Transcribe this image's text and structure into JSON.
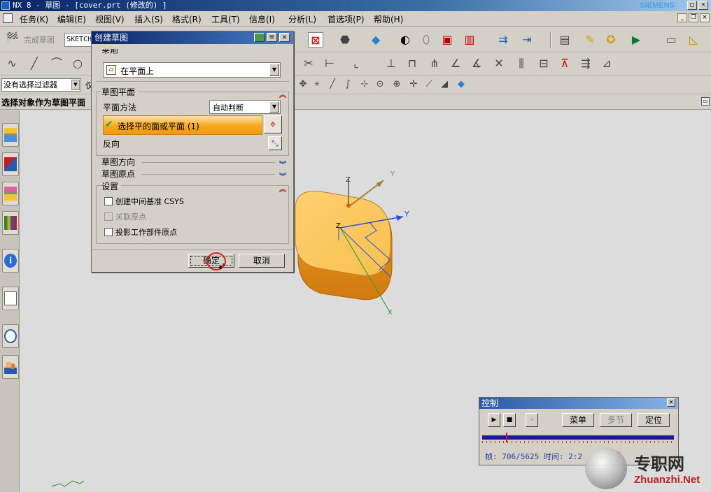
{
  "window": {
    "title": "NX 8 - 草图 - [cover.prt (修改的) ]",
    "brand": "SIEMENS"
  },
  "menu": [
    "任务(K)",
    "编辑(E)",
    "视图(V)",
    "插入(S)",
    "格式(R)",
    "工具(T)",
    "信息(I)",
    "分析(L)",
    "首选项(P)",
    "帮助(H)"
  ],
  "sketch_toolbar": {
    "finish_label": "完成草图",
    "sketch_name": "SKETCH_"
  },
  "filter": {
    "value": "没有选择过滤器",
    "partial": "仅"
  },
  "prompt": "选择对象作为草图平面",
  "dialog": {
    "title": "创建草图",
    "type_group": "类型",
    "type_value": "在平面上",
    "plane_group": "草图平面",
    "plane_method_label": "平面方法",
    "plane_method_value": "自动判断",
    "select_face_label": "选择平的面或平面 (1)",
    "reverse_label": "反向",
    "orientation_group": "草图方向",
    "origin_group": "草图原点",
    "settings_group": "设置",
    "opt1": "创建中间基准 CSYS",
    "opt2": "关联原点",
    "opt3": "投影工作部件原点",
    "ok": "确定",
    "cancel": "取消"
  },
  "axes": {
    "x": "X",
    "y": "Y",
    "z": "Z"
  },
  "control": {
    "title": "控制",
    "menu_btn": "菜单",
    "multi_btn": "多节",
    "locate_btn": "定位",
    "frame_label": "帧: 706/5625 时间: 2:2",
    "frame_tail": "5",
    "progress": 0.125
  },
  "watermark": {
    "cn": "专职网",
    "url": "Zhuanzhi.Net"
  }
}
